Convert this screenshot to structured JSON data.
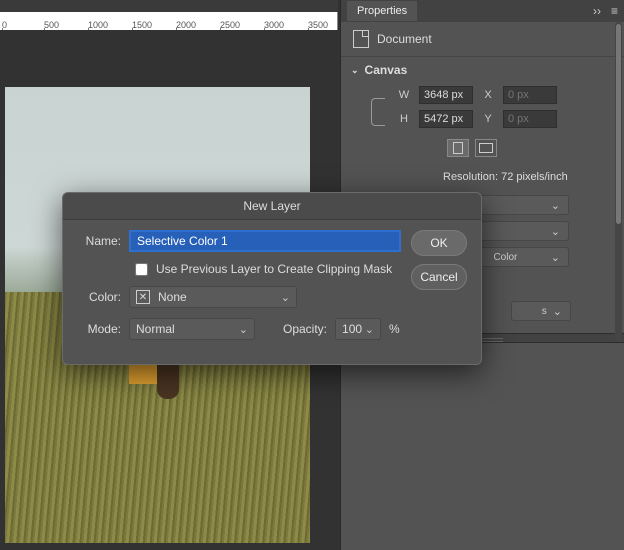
{
  "ruler": {
    "ticks": [
      "0",
      "500",
      "1000",
      "1500",
      "2000",
      "2500",
      "3000",
      "3500"
    ]
  },
  "panel": {
    "tab": "Properties",
    "doc_label": "Document",
    "canvas_label": "Canvas",
    "w_label": "W",
    "w_value": "3648 px",
    "h_label": "H",
    "h_value": "5472 px",
    "x_label": "X",
    "x_placeholder": "0 px",
    "y_label": "Y",
    "y_placeholder": "0 px",
    "resolution": "Resolution: 72 pixels/inch",
    "color_sel_text": "Color",
    "s_sel_text": "s"
  },
  "dialog": {
    "title": "New Layer",
    "name_label": "Name:",
    "name_value": "Selective Color 1",
    "clip_label": "Use Previous Layer to Create Clipping Mask",
    "color_label": "Color:",
    "color_value": "None",
    "mode_label": "Mode:",
    "mode_value": "Normal",
    "opacity_label": "Opacity:",
    "opacity_value": "100",
    "opacity_unit": "%",
    "ok": "OK",
    "cancel": "Cancel"
  }
}
